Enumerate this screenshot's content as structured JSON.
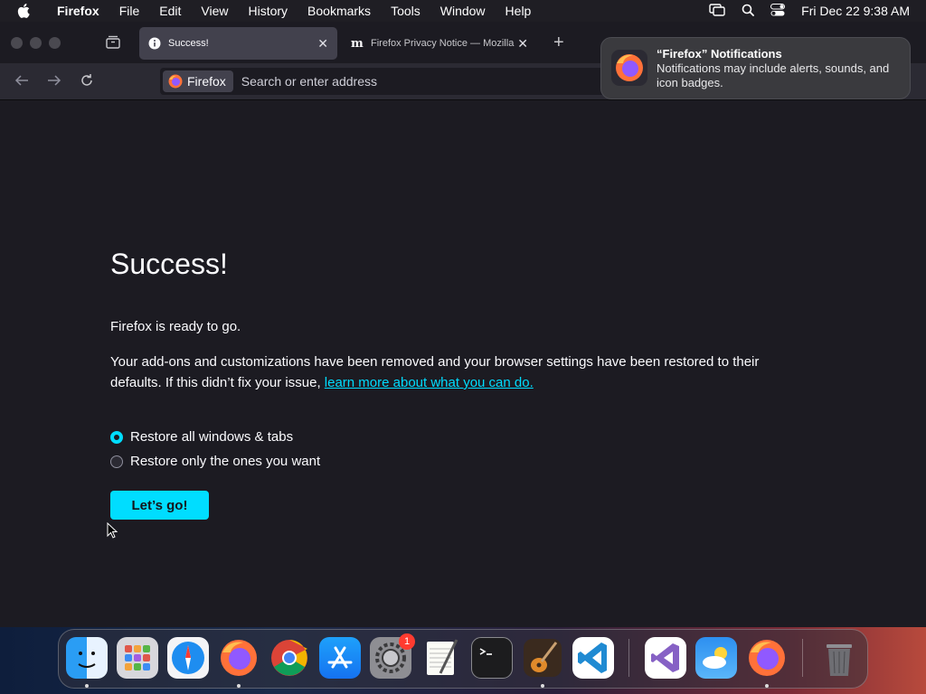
{
  "menubar": {
    "app_name": "Firefox",
    "items": [
      "File",
      "Edit",
      "View",
      "History",
      "Bookmarks",
      "Tools",
      "Window",
      "Help"
    ],
    "clock": "Fri Dec 22  9:38 AM"
  },
  "tabs": [
    {
      "title": "Success!",
      "active": true
    },
    {
      "title": "Firefox Privacy Notice — Mozilla",
      "active": false
    }
  ],
  "urlbar": {
    "identity_label": "Firefox",
    "placeholder": "Search or enter address"
  },
  "page": {
    "heading": "Success!",
    "ready_text": "Firefox is ready to go.",
    "body_text": "Your add-ons and customizations have been removed and your browser settings have been restored to their defaults. If this didn’t fix your issue, ",
    "link_text": "learn more about what you can do.",
    "radio_options": [
      {
        "label": "Restore all windows & tabs",
        "checked": true
      },
      {
        "label": "Restore only the ones you want",
        "checked": false
      }
    ],
    "button_label": "Let’s go!"
  },
  "notification": {
    "title": "“Firefox” Notifications",
    "body": "Notifications may include alerts, sounds, and icon badges."
  },
  "dock": {
    "apps": [
      "Finder",
      "Launchpad",
      "Safari",
      "Firefox",
      "Google Chrome",
      "App Store",
      "System Settings",
      "TextEdit",
      "Terminal",
      "GarageBand",
      "Visual Studio Code",
      "Visual Studio",
      "Weather",
      "Firefox",
      "Trash"
    ],
    "settings_badge": "1"
  },
  "colors": {
    "accent": "#00ddff",
    "page_background": "#1c1b22",
    "toolbar": "#2b2a33"
  }
}
